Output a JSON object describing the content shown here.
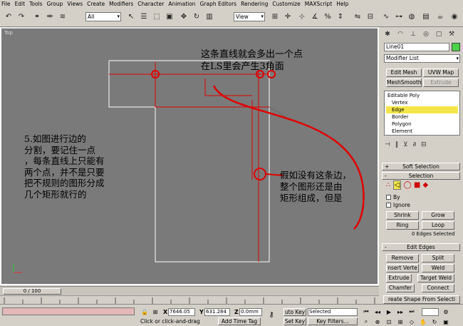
{
  "menu": [
    "File",
    "Edit",
    "Tools",
    "Group",
    "Views",
    "Create",
    "Modifiers",
    "Character",
    "Animation",
    "Graph Editors",
    "Rendering",
    "Customize",
    "MAXScript",
    "Help"
  ],
  "toolbar": {
    "selection_filter": "All",
    "coord_system": "View"
  },
  "viewport": {
    "label": "Top",
    "note_top": "这条直线就会多出一个点\n在LS里会产生3角面",
    "note_left": "5.如图进行边的\n分割，要记住一点\n，每条直线上只能有\n两个点，并不是只要\n把不规则的图形分成\n几个矩形就行的",
    "note_right": "假如没有这条边，\n整个图形还是由\n矩形组成，但是"
  },
  "panel": {
    "object_name": "Line01",
    "modifier_list": "Modifier List",
    "buttons": {
      "edit_mesh": "Edit Mesh",
      "uvw_map": "UVW Map",
      "meshsmooth": "MeshSmooth",
      "extrude": "Extrude"
    },
    "stack": {
      "root": "Editable Poly",
      "items": [
        "Vertex",
        "Edge",
        "Border",
        "Polygon",
        "Element"
      ]
    },
    "soft_selection": "Soft Selection",
    "selection": "Selection",
    "by": "By",
    "ignore": "Ignore",
    "shrink": "Shrink",
    "grow": "Grow",
    "ring": "Ring",
    "loop": "Loop",
    "selected_count": "0 Edges Selected",
    "edit_edges": "Edit Edges",
    "remove": "Remove",
    "split": "Split",
    "insert_vertex": "nsert Verte",
    "weld": "Weld",
    "extrude_btn": "Extrude",
    "target_weld": "Target Weld",
    "chamfer": "Chamfer",
    "connect": "Connect",
    "create_shape": "reate Shape From Selecti"
  },
  "timeline": {
    "frame": "0 / 100"
  },
  "status": {
    "x_label": "X",
    "x_value": "7646.05",
    "y_label": "Y",
    "y_value": "631.284",
    "z_label": "Z",
    "z_value": "0.0mm",
    "prompt": "Click or click-and-drag",
    "add_time_tag": "Add Time Tag",
    "auto_key": "uto Key",
    "set_key": "Set Key",
    "selected": "Selected",
    "key_filters": "Key Filters..."
  },
  "colors": {
    "viewport_bg": "#7a7a7a",
    "annotation_red": "#e00000",
    "edge_highlight": "#f4e64a"
  }
}
